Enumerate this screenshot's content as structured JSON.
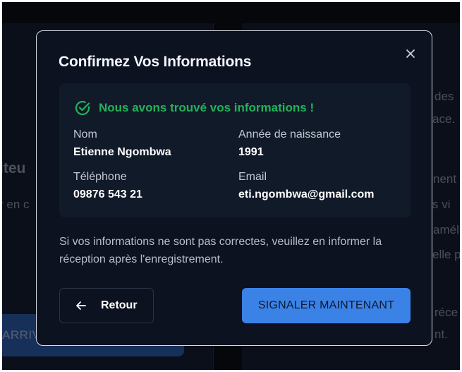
{
  "background": {
    "heading_fragment": "iteu",
    "text_left_fragment": "r en c",
    "button_fragment": "ARRIV",
    "right_fragments": [
      "des",
      "ace.",
      "nent",
      "s vi",
      "amél",
      "elle p",
      "réce",
      "nt."
    ]
  },
  "modal": {
    "title": "Confirmez Vos Informations",
    "success_message": "Nous avons trouvé vos informations !",
    "fields": [
      {
        "label": "Nom",
        "value": "Etienne Ngombwa"
      },
      {
        "label": "Année de naissance",
        "value": "1991"
      },
      {
        "label": "Téléphone",
        "value": "09876 543 21"
      },
      {
        "label": "Email",
        "value": "eti.ngombwa@gmail.com"
      }
    ],
    "note": "Si vos informations ne sont pas correctes, veuillez en informer la réception après l'enregistrement.",
    "back_label": "Retour",
    "report_label": "SIGNALER MAINTENANT"
  },
  "colors": {
    "success": "#22b35a",
    "accent": "#3b82e6",
    "modal_bg": "#0c1220",
    "card_bg": "#111a29"
  },
  "icons": {
    "close": "close-icon",
    "success": "check-circle-icon",
    "back": "arrow-left-icon"
  }
}
